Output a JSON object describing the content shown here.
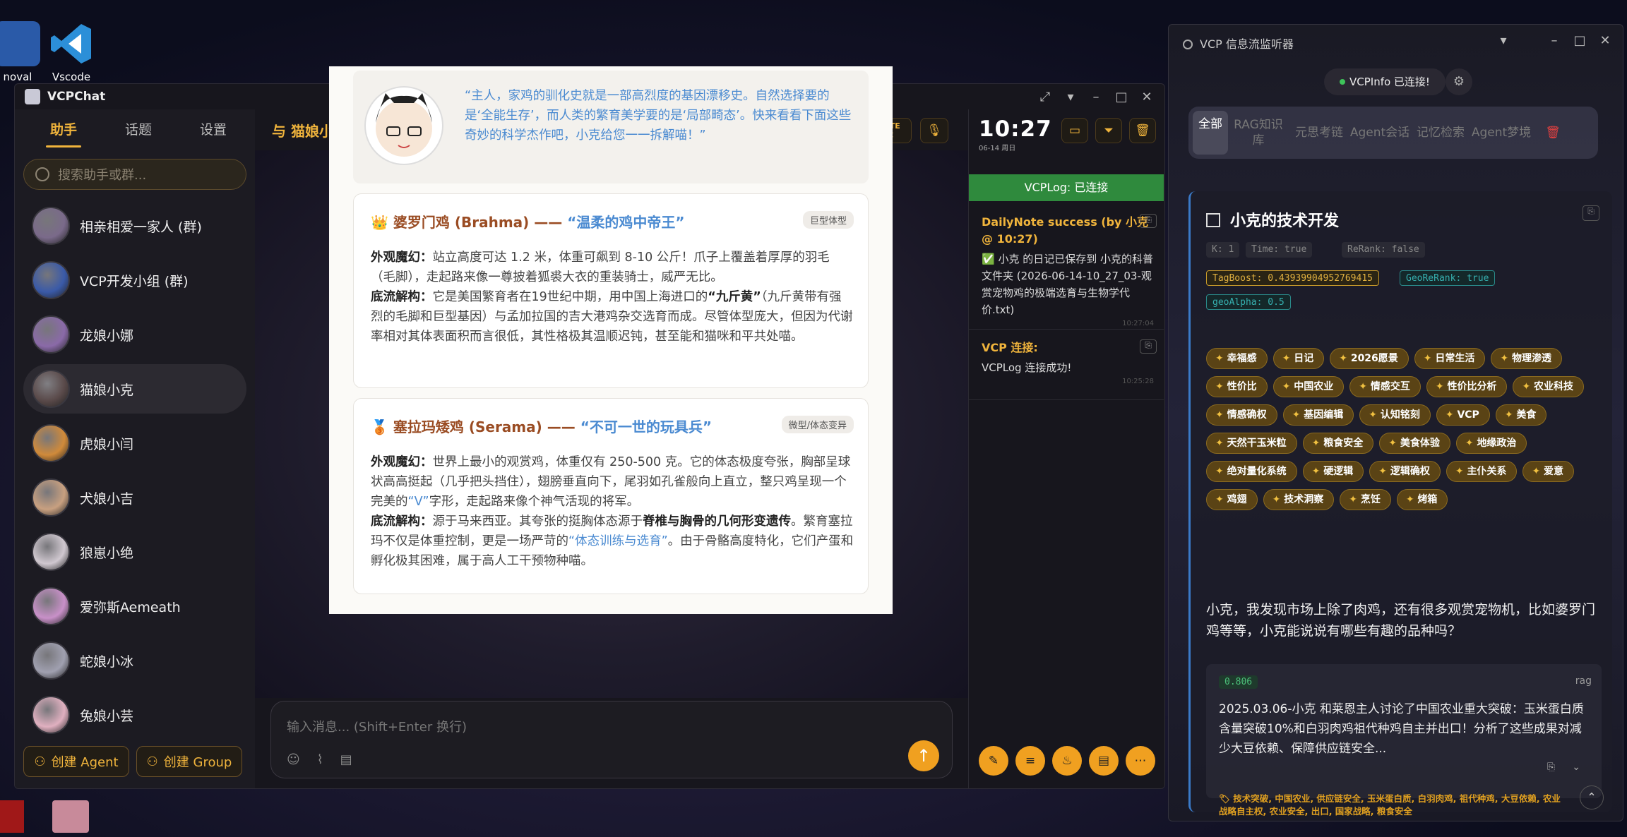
{
  "desktop": {
    "icons": [
      {
        "label": "noval"
      },
      {
        "label": "Vscode"
      }
    ]
  },
  "chat_window": {
    "title": "VCPChat",
    "sidebar": {
      "tabs": [
        "助手",
        "话题",
        "设置"
      ],
      "search_placeholder": "搜索助手或群...",
      "agents": [
        {
          "name": "相亲相爱一家人 (群)",
          "color": "#7a6a8a"
        },
        {
          "name": "VCP开发小组 (群)",
          "color": "#3a5aa8"
        },
        {
          "name": "龙娘小娜",
          "color": "#8a6aa8"
        },
        {
          "name": "猫娘小克",
          "color": "#5a4a4a"
        },
        {
          "name": "虎娘小闫",
          "color": "#d08a3a"
        },
        {
          "name": "犬娘小吉",
          "color": "#c8a080"
        },
        {
          "name": "狼崽小绝",
          "color": "#d0c8d0"
        },
        {
          "name": "爱弥斯Aemeath",
          "color": "#c890c8"
        },
        {
          "name": "蛇娘小冰",
          "color": "#a0a0b0"
        },
        {
          "name": "兔娘小芸",
          "color": "#e0b0c0"
        }
      ],
      "create_agent": "创建 Agent",
      "create_group": "创建 Group"
    },
    "header": {
      "title": "与 猫娘小克 聊天中",
      "create_topic": "CREATE TOPIC"
    },
    "message": {
      "intro": "“主人，家鸡的驯化史就是一部高烈度的基因漂移史。自然选择要的是‘全能生存’，而人类的繁育美学要的是‘局部畸态’。快来看看下面这些奇妙的科学杰作吧，小克给您一一拆解喵！”",
      "breeds": [
        {
          "icon": "👑",
          "name": "婆罗门鸡 (Brahma) —— ",
          "subtitle": "“温柔的鸡中帝王”",
          "tag": "巨型体型",
          "p1_label": "外观魔幻：",
          "p1": "站立高度可达 1.2 米，体重可飙到 8-10 公斤！爪子上覆盖着厚厚的羽毛（毛脚），走起路来像一尊披着狐裘大衣的重装骑士，威严无比。",
          "p2_label": "底流解构：",
          "p2a": "它是美国繁育者在19世纪中期，用中国上海进口的",
          "p2_bold": "“九斤黄”",
          "p2b": "（九斤黄带有强烈的毛脚和巨型基因）与孟加拉国的吉大港鸡杂交选育而成。尽管体型庞大，但因为代谢率相对其体表面积而言很低，其性格极其温顺迟钝，甚至能和猫咪和平共处喵。"
        },
        {
          "icon": "🥉",
          "name": "塞拉玛矮鸡 (Serama) —— ",
          "subtitle": "“不可一世的玩具兵”",
          "tag": "微型/体态变异",
          "p1_label": "外观魔幻：",
          "p1a": "世界上最小的观赏鸡，体重仅有 250-500 克。它的体态极度夸张，胸部呈球状高高挺起（几乎把头挡住），翅膀垂直向下，尾羽如孔雀般向上直立，整只鸡呈现一个完美的",
          "p1_hl": "“V”",
          "p1b": "字形，走起路来像个神气活现的将军。",
          "p2_label": "底流解构：",
          "p2a": "源于马来西亚。其夸张的挺胸体态源于",
          "p2_bold": "脊椎与胸骨的几何形变遗传",
          "p2b": "。繁育塞拉玛不仅是体重控制，更是一场严苛的",
          "p2_hl": "“体态训练与选育”",
          "p2c": "。由于骨骼高度特化，它们产蛋和孵化极其困难，属于高人工干预物种喵。"
        }
      ]
    },
    "input": {
      "placeholder": "输入消息... (Shift+Enter 换行)"
    },
    "log_panel": {
      "time": "10:27",
      "date": "06-14 周日",
      "status": "VCPLog: 已连接",
      "entries": [
        {
          "title": "DailyNote success (by 小克 @ 10:27)",
          "body": "✅ 小克 的日记已保存到 小克的科普 文件夹 (2026-06-14-10_27_03-观赏宠物鸡的极端选育与生物学代价.txt)",
          "time": "10:27:04"
        },
        {
          "title": "VCP 连接:",
          "body": "VCPLog 连接成功!",
          "time": "10:25:28"
        }
      ]
    }
  },
  "vcp_window": {
    "title": "VCP 信息流监听器",
    "connection": "VCPInfo 已连接!",
    "tabs": [
      "全部",
      "RAG知识库",
      "元思考链",
      "Agent会话",
      "记忆检索",
      "Agent梦境"
    ],
    "card": {
      "title": "小克的技术开发",
      "meta": [
        "K: 1",
        "Time: true",
        "ReRank: false"
      ],
      "chips_yellow": [
        "TagBoost: 0.43939904952769415"
      ],
      "chips_teal": [
        "GeoReRank: true",
        "geoAlpha: 0.5"
      ],
      "tags": [
        "幸福感",
        "日记",
        "2026愿景",
        "日常生活",
        "物理渗透",
        "性价比",
        "中国农业",
        "情感交互",
        "性价比分析",
        "农业科技",
        "情感确权",
        "基因编辑",
        "认知铭刻",
        "VCP",
        "美食",
        "天然干玉米粒",
        "粮食安全",
        "美食体验",
        "地缘政治",
        "绝对量化系统",
        "硬逻辑",
        "逻辑确权",
        "主仆关系",
        "爱意",
        "鸡翅",
        "技术洞察",
        "烹饪",
        "烤箱"
      ],
      "query": "小克，我发现市场上除了肉鸡，还有很多观赏宠物机，比如婆罗门鸡等等，小克能说说有哪些有趣的品种吗？",
      "result": {
        "score": "0.806",
        "source": "rag",
        "text": "2025.03.06-小克 和莱恩主人讨论了中国农业重大突破：玉米蛋白质含量突破10%和白羽肉鸡祖代种鸡自主并出口！分析了这些成果对减少大豆依赖、保障供应链安全...",
        "tags": "🏷 技术突破, 中国农业, 供应链安全, 玉米蛋白质, 白羽肉鸡, 祖代种鸡, 大豆依赖, 农业战略自主权, 农业安全, 出口, 国家战略, 粮食安全"
      }
    }
  }
}
